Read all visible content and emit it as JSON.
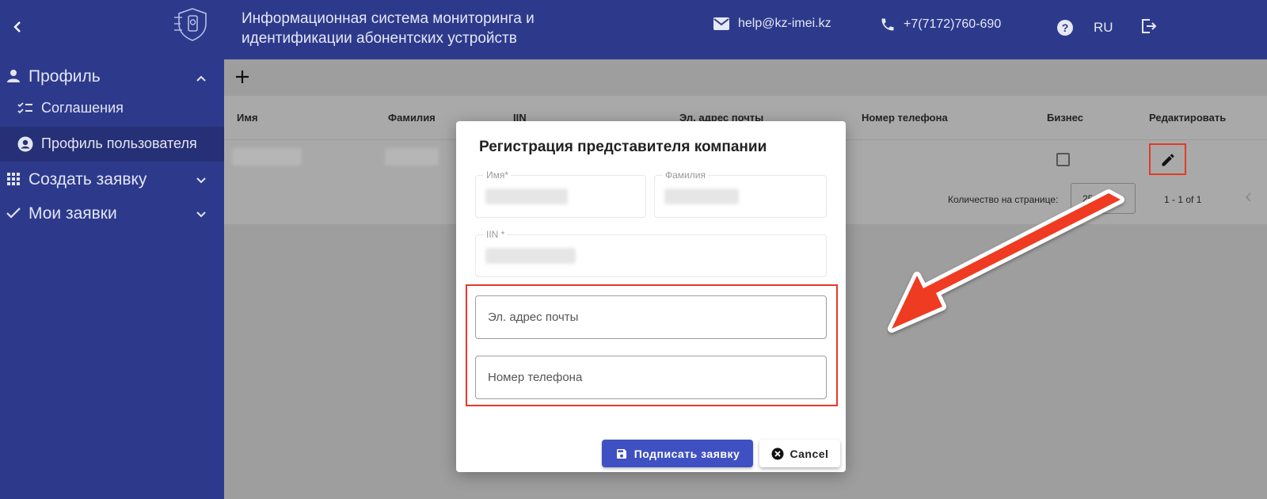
{
  "header": {
    "system_title": "Информационная система мониторинга и идентификации абонентских устройств",
    "email": "help@kz-imei.kz",
    "phone": "+7(7172)760-690",
    "language": "RU"
  },
  "sidebar": {
    "profile": "Профиль",
    "agreements": "Соглашения",
    "user_profile": "Профиль пользователя",
    "create_request": "Создать заявку",
    "my_requests": "Мои заявки"
  },
  "table": {
    "columns": [
      "Имя",
      "Фамилия",
      "IIN",
      "Эл. адрес почты",
      "Номер телефона",
      "Бизнес",
      "Редактировать"
    ],
    "per_page_label": "Количество на странице:",
    "per_page_value": "25",
    "range": "1 - 1 of 1"
  },
  "dialog": {
    "title": "Регистрация представителя компании",
    "first_name_label": "Имя*",
    "last_name_label": "Фамилия",
    "iin_label": "IIN *",
    "email_placeholder": "Эл. адрес почты",
    "phone_placeholder": "Номер телефона",
    "sign_button": "Подписать заявку",
    "cancel_button": "Cancel"
  },
  "colors": {
    "primary": "#2d3a8c",
    "button": "#3f51c2",
    "highlight": "#e53929"
  }
}
